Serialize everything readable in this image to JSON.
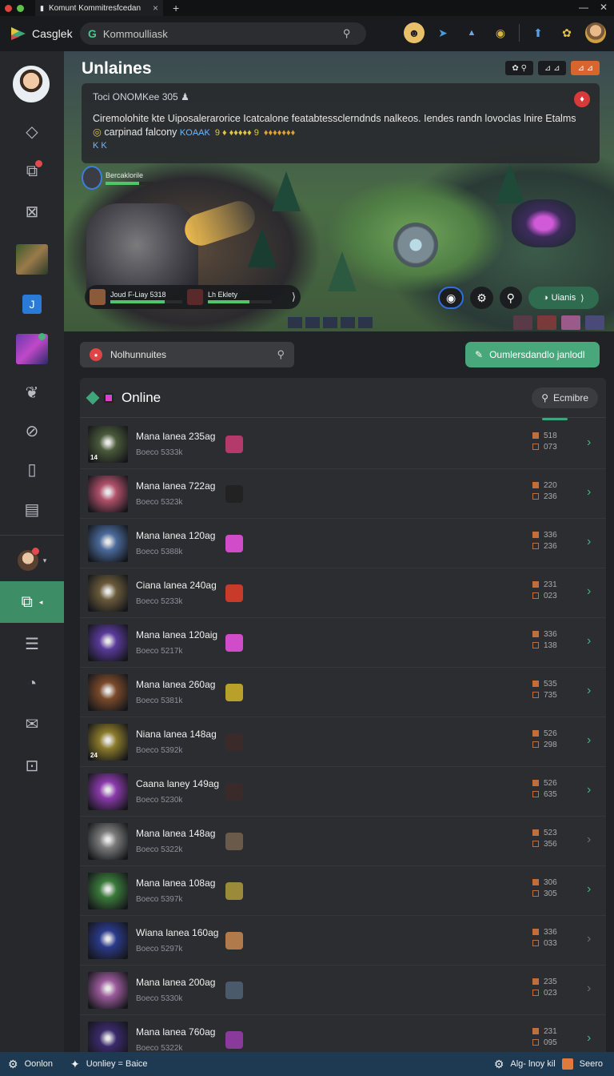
{
  "window": {
    "tab_title": "Komunt Kommitresfcedan",
    "colors": {
      "close": "#e0443e",
      "min": "#5ec24b",
      "accent": "#49a87b"
    }
  },
  "header": {
    "brand": "Casglek",
    "search_value": "Kommoulliask",
    "icons": [
      "avatar-icon",
      "send-icon",
      "triangle-icon",
      "compass-icon",
      "rocket-icon",
      "pet-icon",
      "user-avatar"
    ]
  },
  "sidebar": {
    "items": [
      {
        "name": "diamond-icon"
      },
      {
        "name": "bookmark-icon"
      },
      {
        "name": "inbox-icon"
      },
      {
        "name": "game-thumb"
      },
      {
        "name": "tag-icon"
      },
      {
        "name": "game-thumb-2"
      },
      {
        "name": "leaf-icon"
      },
      {
        "name": "target-icon"
      },
      {
        "name": "book-icon"
      },
      {
        "name": "document-icon"
      },
      {
        "name": "user-icon"
      },
      {
        "name": "library-icon"
      },
      {
        "name": "list-icon"
      },
      {
        "name": "clock-icon"
      },
      {
        "name": "chat-icon"
      },
      {
        "name": "export-icon"
      }
    ]
  },
  "banner": {
    "title": "Unlaines",
    "chips": [
      "✿  ⚲",
      "⊿  ⊿",
      "⊿  ⊿"
    ],
    "notice_head": "Toci ONOMKee 305",
    "notice_body": "Ciremolohite kte Uiposalerarorice Icatcalone featabtessclerndnds nalkeos. Iendes randn lovoclas lnire Etalms",
    "notice_body_2": "carpinad falcony",
    "notice_tags": [
      "KOAAK",
      "9 ♦ ♦♦♦♦♦ 9",
      "♦♦♦♦♦♦♦"
    ],
    "notice_footer": "K K",
    "char_label": "Bercaklorile",
    "player_bar": [
      "Joud F-Liay 5318",
      "Lh Eklety"
    ],
    "green_button": "Uianis"
  },
  "friends": {
    "search_value": "Nolhunnuites",
    "action_button": "Oumlersdandlo janlodl",
    "panel_title": "Online",
    "panel_button": "Ecmibre"
  },
  "rows": [
    {
      "name": "Mana lanea 235ag",
      "sub": "Boeco 5333k",
      "level": "14",
      "s1": "518",
      "s2": "073",
      "thumb": "#4a5a3a",
      "mini": "#b33a6a",
      "chev": "active"
    },
    {
      "name": "Mana lanea 722ag",
      "sub": "Boeco 5323k",
      "level": "",
      "s1": "220",
      "s2": "236",
      "thumb": "#b0506a",
      "mini": "#222222",
      "chev": "active"
    },
    {
      "name": "Mana lanea 120ag",
      "sub": "Boeco 5388k",
      "level": "",
      "s1": "336",
      "s2": "236",
      "thumb": "#4a6a9a",
      "mini": "#d04cc8",
      "chev": "active"
    },
    {
      "name": "Ciana lanea 240ag",
      "sub": "Boeco 5233k",
      "level": "",
      "s1": "231",
      "s2": "023",
      "thumb": "#6a5a3a",
      "mini": "#c83a2a",
      "chev": "active"
    },
    {
      "name": "Mana lanea 120aig",
      "sub": "Boeco 5217k",
      "level": "",
      "s1": "336",
      "s2": "138",
      "thumb": "#5a3a9a",
      "mini": "#d04cc8",
      "chev": "active"
    },
    {
      "name": "Mana lanea 260ag",
      "sub": "Boeco 5381k",
      "level": "",
      "s1": "535",
      "s2": "735",
      "thumb": "#7a4a2a",
      "mini": "#b8a02a",
      "chev": "active"
    },
    {
      "name": "Niana lanea 148ag",
      "sub": "Boeco 5392k",
      "level": "24",
      "s1": "526",
      "s2": "298",
      "thumb": "#8a7a2a",
      "mini": "#3a2a2a",
      "chev": "active"
    },
    {
      "name": "Caana laney 149ag",
      "sub": "Boeco 5230k",
      "level": "",
      "s1": "526",
      "s2": "635",
      "thumb": "#8a3aaa",
      "mini": "#3a2a2a",
      "chev": "active"
    },
    {
      "name": "Mana lanea 148ag",
      "sub": "Boeco 5322k",
      "level": "",
      "s1": "523",
      "s2": "356",
      "thumb": "#7a7a7a",
      "mini": "#6a5a4a",
      "chev": "dim"
    },
    {
      "name": "Mana lanea 108ag",
      "sub": "Boeco 5397k",
      "level": "",
      "s1": "306",
      "s2": "305",
      "thumb": "#3a7a3a",
      "mini": "#9a8a3a",
      "chev": "active"
    },
    {
      "name": "Wiana lanea 160ag",
      "sub": "Boeco 5297k",
      "level": "",
      "s1": "336",
      "s2": "033",
      "thumb": "#2a3a8a",
      "mini": "#b07a4a",
      "chev": "dim"
    },
    {
      "name": "Mana lanea 200ag",
      "sub": "Boeco 5330k",
      "level": "",
      "s1": "235",
      "s2": "023",
      "thumb": "#9a5a9a",
      "mini": "#4a5a6a",
      "chev": "dim"
    },
    {
      "name": "Mana lanea 760ag",
      "sub": "Boeco 5322k",
      "level": "",
      "s1": "231",
      "s2": "095",
      "thumb": "#3a2a6a",
      "mini": "#8a3a9a",
      "chev": "active"
    }
  ],
  "statusbar": {
    "left_1": "Oonlon",
    "left_2": "Uonliey = Baice",
    "right_1": "Alg- lnoy kil",
    "right_2": "Seero"
  }
}
